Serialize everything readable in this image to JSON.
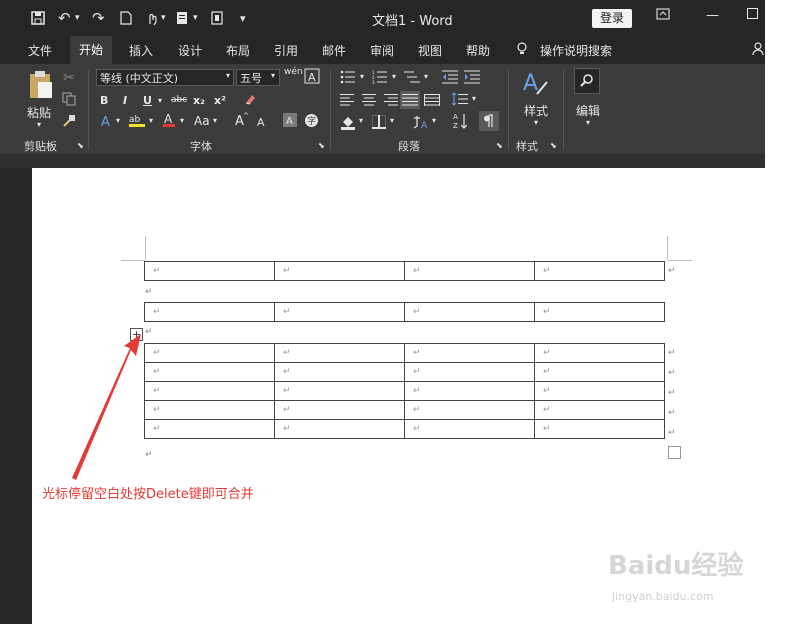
{
  "titlebar": {
    "doc_title": "文档1 - Word",
    "login": "登录",
    "save_icon": "save-icon",
    "undo_icon": "undo-icon",
    "redo_icon": "redo-icon"
  },
  "tabs": [
    "文件",
    "开始",
    "插入",
    "设计",
    "布局",
    "引用",
    "邮件",
    "审阅",
    "视图",
    "帮助",
    "操作说明搜索"
  ],
  "ribbon": {
    "clipboard": {
      "paste": "粘贴",
      "label": "剪贴板"
    },
    "font": {
      "name": "等线 (中文正文)",
      "size": "五号",
      "wen": "wén",
      "label": "字体",
      "bold": "B",
      "italic": "I",
      "underline": "U",
      "strike": "abc",
      "sub": "x₂",
      "sup": "x²",
      "aa": "Aa"
    },
    "paragraph": {
      "label": "段落"
    },
    "styles": {
      "btn": "样式",
      "label": "样式"
    },
    "editing": {
      "btn": "编辑"
    }
  },
  "document": {
    "para_mark": "↵",
    "handle": "+",
    "annotation": "光标停留空白处按Delete键即可合并"
  },
  "watermark": {
    "text": "Baidu经验",
    "sub": "jingyan.baidu.com"
  }
}
